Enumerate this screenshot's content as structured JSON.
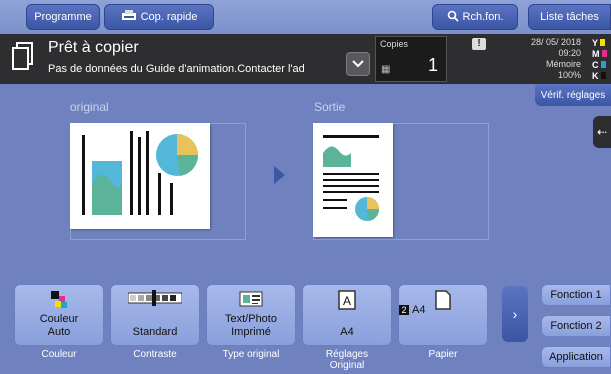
{
  "topbar": {
    "programme": "Programme",
    "cop_rapide": "Cop. rapide",
    "rch_fon": "Rch.fon.",
    "liste_taches": "Liste tâches"
  },
  "status": {
    "title": "Prêt à copier",
    "message": "Pas de données du Guide d'animation.Contacter l'ad",
    "copies_label": "Copies",
    "copies_value": "1",
    "date": "28/ 05/ 2018",
    "time": "09:20",
    "memory_label": "Mémoire",
    "memory_value": "100%",
    "toners": [
      "Y",
      "M",
      "C",
      "K"
    ],
    "toner_colors": [
      "#f2e200",
      "#e0308c",
      "#22a0d8",
      "#111111"
    ]
  },
  "verif_button": "Vérif. réglages",
  "preview": {
    "original_label": "original",
    "output_label": "Sortie"
  },
  "functions": [
    {
      "value": "Couleur\nAuto",
      "label": "Couleur"
    },
    {
      "value": "Standard",
      "label": "Contraste"
    },
    {
      "value": "Text/Photo\nImprimé",
      "label": "Type original"
    },
    {
      "value": "A4",
      "label": "Réglages\nOriginal"
    },
    {
      "value": "A4",
      "tray": "2",
      "label": "Papier"
    }
  ],
  "side_functions": {
    "f1": "Fonction 1",
    "f2": "Fonction 2",
    "app": "Application"
  }
}
